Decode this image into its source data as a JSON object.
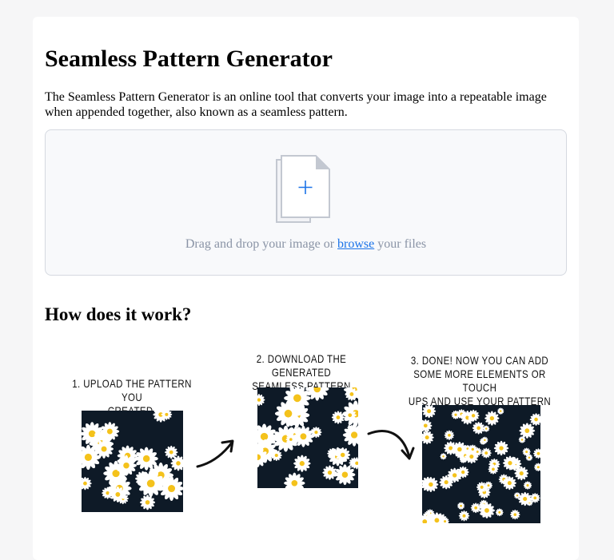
{
  "page": {
    "title": "Seamless Pattern Generator",
    "intro": "The Seamless Pattern Generator is an online tool that converts your image into a repeatable image when appended together, also known as a seamless pattern."
  },
  "dropzone": {
    "text_before": "Drag and drop your image or",
    "browse_link": "browse",
    "text_after": "your files",
    "icon": "add-file-icon"
  },
  "how_it_works": {
    "title": "How does it work?",
    "steps": [
      {
        "caption": "1. Upload the pattern you\ncreated."
      },
      {
        "caption": "2. Download  the generated\nseamless pattern"
      },
      {
        "caption": "3. DONE! Now you can add\nsome more elements or touch\nups and use your pattern"
      }
    ]
  },
  "colors": {
    "accent": "#1a73e8",
    "pattern_background": "#0e1a27",
    "petal": "#ffffff",
    "flower_center": "#f4c21b"
  }
}
